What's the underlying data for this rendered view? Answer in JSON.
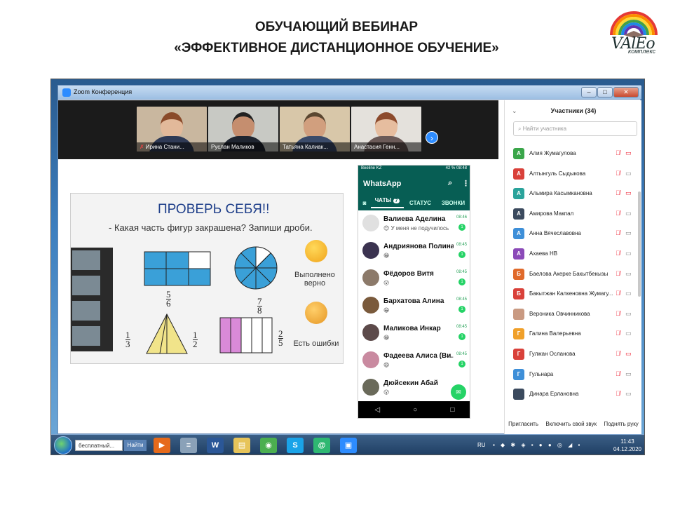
{
  "slide": {
    "title1": "ОБУЧАЮЩИЙ ВЕБИНАР",
    "title2": "«ЭФФЕКТИВНОЕ ДИСТАНЦИОННОЕ ОБУЧЕНИЕ»",
    "logo_main": "VAlЕо",
    "logo_sub": "комплекс"
  },
  "window": {
    "title": "Zoom Конференция"
  },
  "gallery": [
    {
      "name": "Ирина Стани...",
      "muted": true
    },
    {
      "name": "Руслан Маликов",
      "muted": false
    },
    {
      "name": "Татьяна Калиак...",
      "muted": false
    },
    {
      "name": "Анастасия Генн...",
      "muted": false
    }
  ],
  "shared_slide": {
    "heading": "ПРОВЕРЬ СЕБЯ!!",
    "question": "- Какая часть фигур закрашена? Запиши дроби.",
    "fractions": [
      {
        "num": "5",
        "den": "6"
      },
      {
        "num": "7",
        "den": "8"
      },
      {
        "num": "1",
        "den": "3"
      },
      {
        "num": "1",
        "den": "2"
      },
      {
        "num": "2",
        "den": "5"
      }
    ],
    "answer_ok": "Выполнено верно",
    "answer_err": "Есть ошибки"
  },
  "whatsapp": {
    "status": "Beeline KZ",
    "status_right": "42 % 08:48",
    "app_name": "WhatsApp",
    "tabs": {
      "chats": "ЧАТЫ",
      "chats_badge": "7",
      "status": "СТАТУС",
      "calls": "ЗВОНКИ"
    },
    "chats": [
      {
        "name": "Валиева Аделина",
        "msg": "😊 У меня не подучилось",
        "time": "08:46",
        "unread": "1"
      },
      {
        "name": "Андриянова Полина",
        "msg": "😁",
        "time": "08:45",
        "unread": "1"
      },
      {
        "name": "Фёдоров Витя",
        "msg": "😮",
        "time": "08:45",
        "unread": "1"
      },
      {
        "name": "Бархатова Алина",
        "msg": "😁",
        "time": "08:45",
        "unread": "1"
      },
      {
        "name": "Маликова Инкар",
        "msg": "😁",
        "time": "08:45",
        "unread": "1"
      },
      {
        "name": "Фадеева Алиса (Ви...",
        "msg": "😄",
        "time": "08:45",
        "unread": "1"
      },
      {
        "name": "Дюйсекин Абай",
        "msg": "😮",
        "time": "",
        "unread": ""
      }
    ]
  },
  "participants": {
    "title": "Участники (34)",
    "search_placeholder": "Найти участника",
    "list": [
      {
        "initial": "А",
        "name": "Алия Жумагулова",
        "color": "#3aa64a",
        "video_off": true
      },
      {
        "initial": "А",
        "name": "Алтынгуль Сыдыкова",
        "color": "#d9413a",
        "video_off": false
      },
      {
        "initial": "А",
        "name": "Альмира Касымкановна",
        "color": "#2aa39b",
        "video_off": true
      },
      {
        "initial": "А",
        "name": "Амирова Макпал",
        "color": "#3b4a5e",
        "video_off": false
      },
      {
        "initial": "А",
        "name": "Анна Вячеславовна",
        "color": "#3e8fd8",
        "video_off": false
      },
      {
        "initial": "А",
        "name": "Ахаева НВ",
        "color": "#8b4ab8",
        "video_off": false
      },
      {
        "initial": "Б",
        "name": "Баелова Акерке Бакытбекызы",
        "color": "#e06a2b",
        "video_off": false
      },
      {
        "initial": "Б",
        "name": "Бакытжан Калкеновна Жумагу...",
        "color": "#d9413a",
        "video_off": false
      },
      {
        "initial": "",
        "name": "Вероника Овчинникова",
        "color": "#c99a82",
        "video_off": false
      },
      {
        "initial": "Г",
        "name": "Галина Валерьевна",
        "color": "#f0a02a",
        "video_off": false
      },
      {
        "initial": "Г",
        "name": "Гулжан Осланова",
        "color": "#d9413a",
        "video_off": true
      },
      {
        "initial": "Г",
        "name": "Гульнара",
        "color": "#3e8fd8",
        "video_off": false
      },
      {
        "initial": "",
        "name": "Динара Ерлановна",
        "color": "#3b4a5e",
        "video_off": false
      }
    ],
    "footer": {
      "invite": "Пригласить",
      "unmute": "Включить свой звук",
      "raise": "Поднять руку"
    }
  },
  "taskbar": {
    "search_value": "бесплатный...",
    "search_btn": "Найти",
    "lang": "RU",
    "time": "11:43",
    "date": "04.12.2020"
  }
}
